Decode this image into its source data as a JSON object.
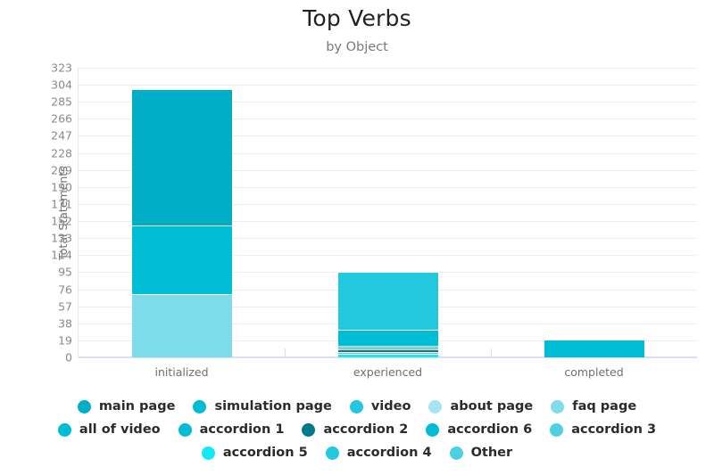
{
  "chart_data": {
    "type": "bar",
    "stacked": true,
    "title": "Top Verbs",
    "subtitle": "by Object",
    "xlabel": "",
    "ylabel": "Total Statements",
    "categories": [
      "initialized",
      "experienced",
      "completed"
    ],
    "ylim": [
      0,
      323
    ],
    "ytick_step": 19,
    "yticks": [
      323,
      304,
      285,
      266,
      247,
      228,
      209,
      190,
      171,
      152,
      133,
      114,
      95,
      76,
      57,
      38,
      19,
      0
    ],
    "grid": true,
    "legend_position": "bottom",
    "series": [
      {
        "name": "main page",
        "color": "#00aec7",
        "values": [
          152,
          0,
          0
        ]
      },
      {
        "name": "simulation page",
        "color": "#00bcd4",
        "values": [
          76,
          0,
          0
        ]
      },
      {
        "name": "video",
        "color": "#22c8dd",
        "values": [
          0,
          64,
          0
        ]
      },
      {
        "name": "about page",
        "color": "#7fdcea",
        "values": [
          52,
          0,
          0
        ]
      },
      {
        "name": "faq page",
        "color": "#7fdcea",
        "values": [
          19,
          0,
          0
        ]
      },
      {
        "name": "all of video",
        "color": "#00bcd4",
        "values": [
          0,
          17,
          0
        ]
      },
      {
        "name": "accordion 1",
        "color": "#00bcd4",
        "values": [
          0,
          0,
          19
        ]
      },
      {
        "name": "accordion 2",
        "color": "#00798c",
        "values": [
          0,
          3,
          0
        ]
      },
      {
        "name": "accordion 6",
        "color": "#00bcd4",
        "values": [
          0,
          2,
          0
        ]
      },
      {
        "name": "accordion 3",
        "color": "#4dd0e1",
        "values": [
          0,
          2,
          0
        ]
      },
      {
        "name": "accordion 5",
        "color": "#12e9f5",
        "values": [
          0,
          2,
          0
        ]
      },
      {
        "name": "accordion 4",
        "color": "#22c8dd",
        "values": [
          0,
          2,
          0
        ]
      },
      {
        "name": "Other",
        "color": "#4dd0e1",
        "values": [
          0,
          3,
          0
        ]
      }
    ],
    "totals": [
      299,
      95,
      19
    ],
    "stacks": [
      {
        "category": "initialized",
        "segments": [
          {
            "name": "faq page",
            "value": 19,
            "color": "#7fdcea"
          },
          {
            "name": "about page",
            "value": 52,
            "color": "#7fdcea"
          },
          {
            "name": "simulation page",
            "value": 76,
            "color": "#00bcd4"
          },
          {
            "name": "main page",
            "value": 152,
            "color": "#00aec7"
          }
        ]
      },
      {
        "category": "experienced",
        "segments": [
          {
            "name": "accordion 5",
            "value": 2,
            "color": "#12e9f5"
          },
          {
            "name": "Other",
            "value": 2,
            "color": "#4dd0e1"
          },
          {
            "name": "accordion 3",
            "value": 2,
            "color": "#4dd0e1"
          },
          {
            "name": "accordion 2",
            "value": 3,
            "color": "#00798c"
          },
          {
            "name": "accordion 6",
            "value": 2,
            "color": "#00bcd4"
          },
          {
            "name": "accordion 4",
            "value": 2,
            "color": "#22c8dd"
          },
          {
            "name": "all of video",
            "value": 18,
            "color": "#00bcd4"
          },
          {
            "name": "video",
            "value": 64,
            "color": "#22c8dd"
          }
        ]
      },
      {
        "category": "completed",
        "segments": [
          {
            "name": "accordion 1",
            "value": 19,
            "color": "#00bcd4"
          }
        ]
      }
    ]
  },
  "legend": {
    "items": [
      {
        "label": "main page",
        "color": "#00aec7"
      },
      {
        "label": "simulation page",
        "color": "#00bcd4"
      },
      {
        "label": "video",
        "color": "#22c8dd"
      },
      {
        "label": "about page",
        "color": "#a5e4f0"
      },
      {
        "label": "faq page",
        "color": "#7fdcea"
      },
      {
        "label": "all of video",
        "color": "#00bcd4"
      },
      {
        "label": "accordion 1",
        "color": "#00bcd4"
      },
      {
        "label": "accordion 2",
        "color": "#00798c"
      },
      {
        "label": "accordion 6",
        "color": "#00bcd4"
      },
      {
        "label": "accordion 3",
        "color": "#4dd0e1"
      },
      {
        "label": "accordion 5",
        "color": "#12e9f5"
      },
      {
        "label": "accordion 4",
        "color": "#22c8dd"
      },
      {
        "label": "Other",
        "color": "#4dd0e1"
      }
    ]
  }
}
